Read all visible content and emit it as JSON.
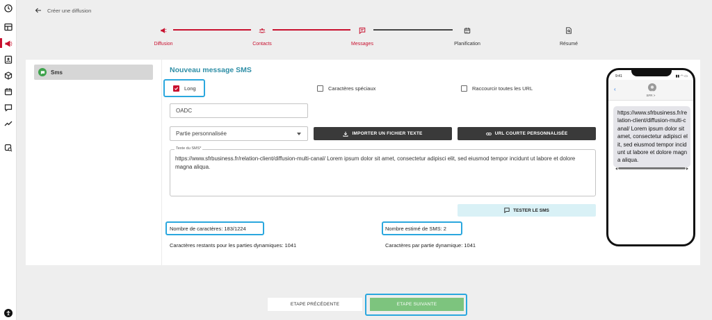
{
  "header": {
    "back_label": "Créer une diffusion"
  },
  "stepper": [
    {
      "label": "Diffusion",
      "state": "done"
    },
    {
      "label": "Contacts",
      "state": "done"
    },
    {
      "label": "Messages",
      "state": "current"
    },
    {
      "label": "Planification",
      "state": "todo"
    },
    {
      "label": "Résumé",
      "state": "todo"
    }
  ],
  "sidebar": {
    "tab_label": "Sms"
  },
  "form": {
    "title": "Nouveau message SMS",
    "checkbox_long": {
      "label": "Long",
      "checked": true
    },
    "checkbox_special": {
      "label": "Caractères spéciaux",
      "checked": false
    },
    "checkbox_shorten": {
      "label": "Raccourcir toutes les URL",
      "checked": false
    },
    "sender_value": "OADC",
    "select_value": "Partie personnalisée",
    "import_button": "IMPORTER UN FICHIER TEXTE",
    "short_url_button": "URL COURTE PERSONNALISÉE",
    "textarea_legend": "Texte du SMS*",
    "textarea_value": "https://www.sfrbusiness.fr/relation-client/diffusion-multi-canal/ Lorem ipsum dolor sit amet, consectetur adipisci elit, sed eiusmod tempor incidunt ut labore et dolore magna aliqua.",
    "test_button": "TESTER LE SMS",
    "char_count": "Nombre de caractères: 183/1224",
    "sms_count": "Nombre estimé de SMS: 2",
    "remaining_dynamic": "Caractères restants pour les parties dynamiques: 1041",
    "per_dynamic": "Caractères par partie dynamique: 1041"
  },
  "phone": {
    "time": "9:41",
    "contact": "SFR >",
    "message": "https://www.sfrbusiness.fr/relation-client/diffusion-multi-canal/ Lorem ipsum dolor sit amet, consectetur adipisci elit, sed eiusmod tempor incidunt ut labore et dolore magna aliqua."
  },
  "footer": {
    "prev_label": "ETAPE PRÉCÉDENTE",
    "next_label": "ETAPE SUIVANTE"
  },
  "colors": {
    "accent_red": "#c8102e",
    "title_teal": "#2e8ea6",
    "highlight_blue": "#2aa7de",
    "next_green": "#7dc47e"
  }
}
